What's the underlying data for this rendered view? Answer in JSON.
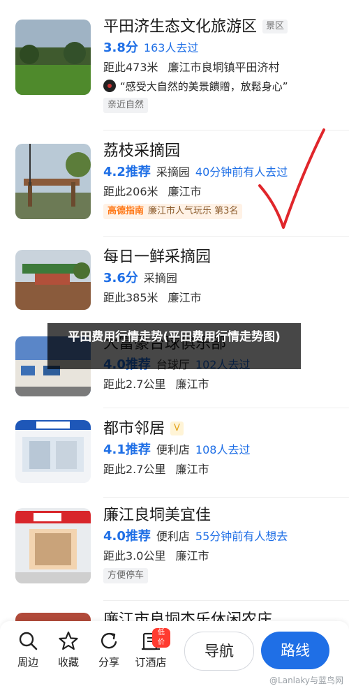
{
  "items": [
    {
      "title": "平田济生态文化旅游区",
      "tag": "景区",
      "score": "3.8分",
      "visit": "163人去过",
      "distance": "距此473米",
      "area": "廉江市良垌镇平田济村",
      "quote": "“感受大自然的美景饋贈，放鬆身心”",
      "chip": "亲近自然"
    },
    {
      "title": "荔枝采摘园",
      "score": "4.2推荐",
      "category": "采摘园",
      "visit": "40分钟前有人去过",
      "distance": "距此206米",
      "area": "廉江市",
      "rank_brand": "高德指南",
      "rank_text": "廉江市人气玩乐 第3名"
    },
    {
      "title": "每日一鲜采摘园",
      "score": "3.6分",
      "category": "采摘园",
      "distance": "距此385米",
      "area": "廉江市"
    },
    {
      "title": "大富豪台球俱乐部",
      "score": "4.0推荐",
      "category": "台球厅",
      "visit": "102人去过",
      "distance": "距此2.7公里",
      "area": "廉江市"
    },
    {
      "title": "都市邻居",
      "vip": "V",
      "score": "4.1推荐",
      "category": "便利店",
      "visit": "108人去过",
      "distance": "距此2.7公里",
      "area": "廉江市"
    },
    {
      "title": "廉江良垌美宜佳",
      "score": "4.0推荐",
      "category": "便利店",
      "visit": "55分钟前有人想去",
      "distance": "距此3.0公里",
      "area": "廉江市",
      "chip": "方便停车"
    },
    {
      "title": "廉江市良垌杰乐休闲农庄"
    }
  ],
  "overlay_text": "平田费用行情走势(平田费用行情走势图)",
  "bottom_bar": {
    "tabs": [
      {
        "label": "周边",
        "icon": "search-icon"
      },
      {
        "label": "收藏",
        "icon": "star-icon"
      },
      {
        "label": "分享",
        "icon": "share-icon"
      },
      {
        "label": "订酒店",
        "icon": "hotel-icon",
        "badge": "低价"
      }
    ],
    "nav_label": "导航",
    "route_label": "路线"
  },
  "watermark": "@Lanlaky与蓝鸟网",
  "colors": {
    "accent": "#1f6fe6",
    "rank_brand": "#ff7a1a",
    "check_mark": "#e0262b"
  }
}
